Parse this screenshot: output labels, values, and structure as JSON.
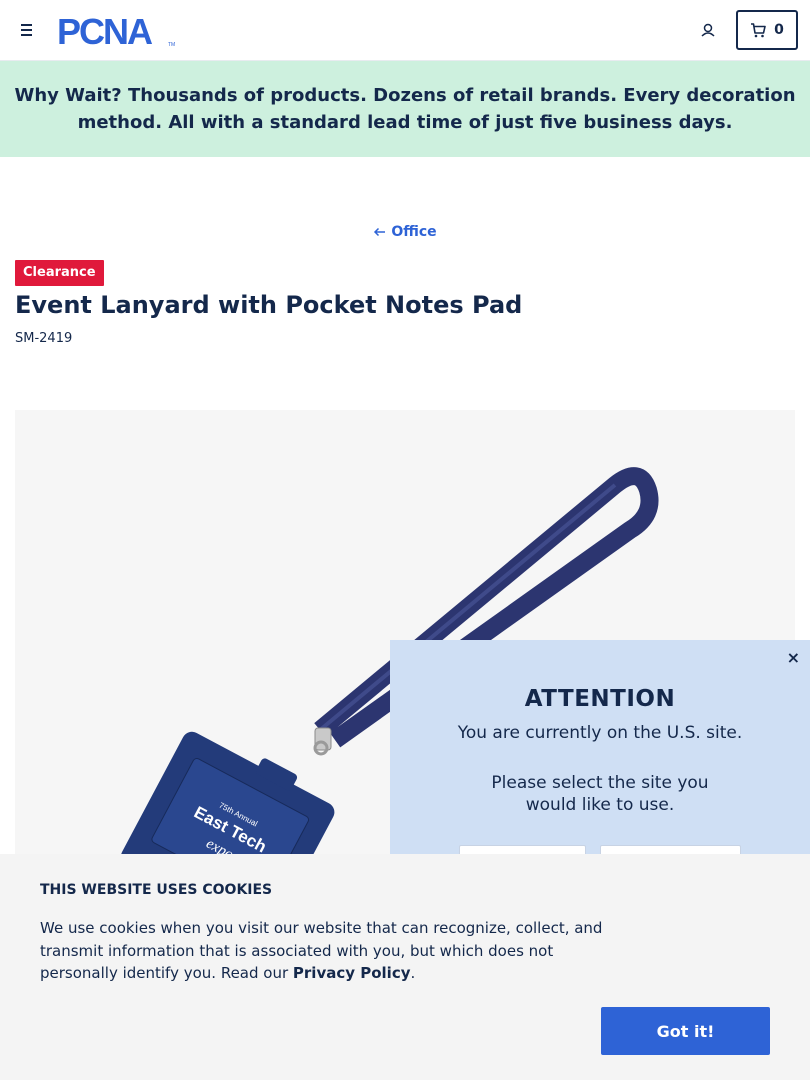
{
  "header": {
    "logo_text": "PCNA",
    "cart_count": "0"
  },
  "banner": {
    "strong": "Why Wait?",
    "text": " Thousands of products. Dozens of retail brands. Every decoration method. All with a standard lead time of just five business days."
  },
  "breadcrumb": {
    "label": "Office"
  },
  "product": {
    "badge": "Clearance",
    "title": "Event Lanyard with Pocket Notes Pad",
    "sku": "SM-2419",
    "imprint_lines": [
      "75th Annual",
      "East Tech",
      "expo"
    ]
  },
  "modal": {
    "close": "×",
    "title": "ATTENTION",
    "line1": "You are currently on the U.S. site.",
    "line2": "Please select the site you would like to use."
  },
  "cookie": {
    "title": "THIS WEBSITE USES COOKIES",
    "text": "We use cookies when you visit our website that can recognize, collect, and transmit information that is associated with you, but which does not personally identify you. Read our ",
    "link": "Privacy Policy",
    "end": ".",
    "button": "Got it!"
  },
  "colors": {
    "navy": "#14284b",
    "accent_blue": "#2e63d6",
    "banner_green": "#cdf0de",
    "clearance_red": "#e0193b",
    "modal_blue": "#cfdff4",
    "lanyard": "#2c3570"
  }
}
